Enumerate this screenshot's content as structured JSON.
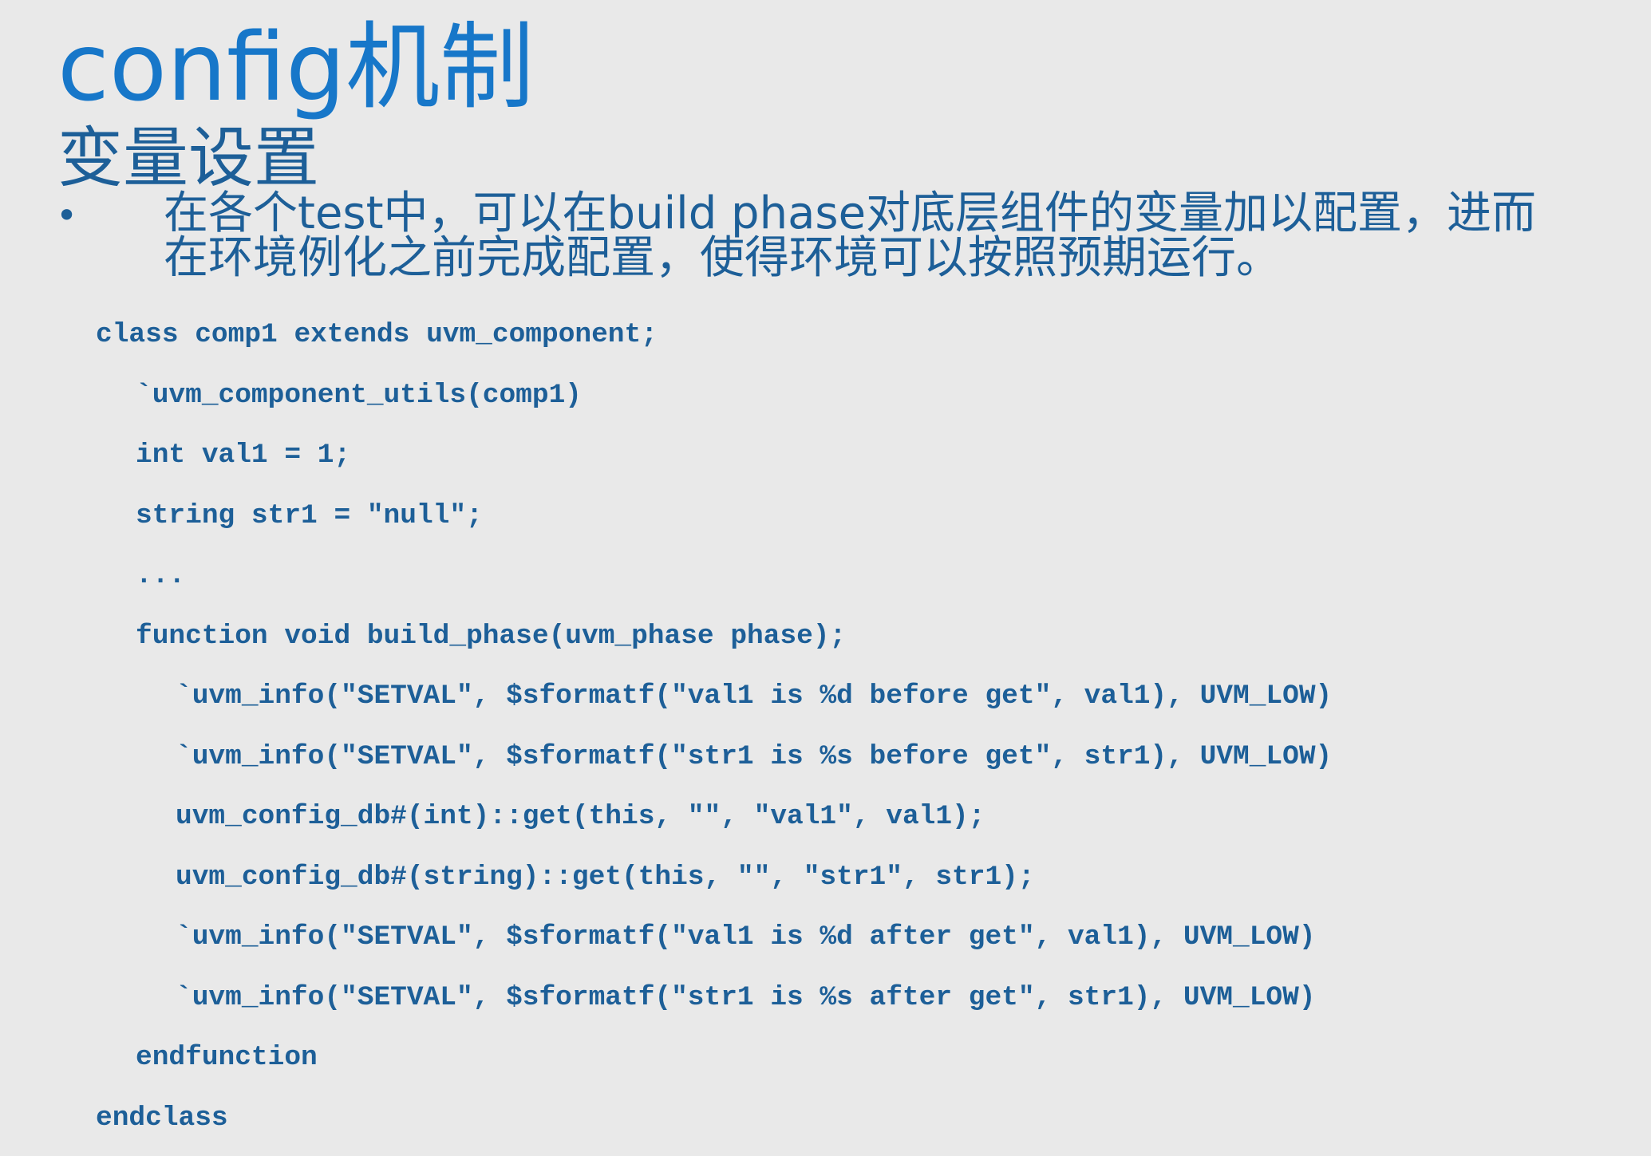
{
  "slide": {
    "title": "config机制",
    "subtitle": "变量设置",
    "bullet": {
      "marker": "•",
      "lines": [
        "在各个test中，可以在build phase对底层组件的变量加以配置，进而",
        "在环境例化之前完成配置，使得环境可以按照预期运行。"
      ]
    },
    "code": [
      "class comp1 extends uvm_component;",
      "`uvm_component_utils(comp1)",
      "int val1 = 1;",
      "string str1 = \"null\";",
      "...",
      "function void build_phase(uvm_phase phase);",
      "`uvm_info(\"SETVAL\", $sformatf(\"val1 is %d before get\", val1), UVM_LOW)",
      "`uvm_info(\"SETVAL\", $sformatf(\"str1 is %s before get\", str1), UVM_LOW)",
      "uvm_config_db#(int)::get(this, \"\", \"val1\", val1);",
      "uvm_config_db#(string)::get(this, \"\", \"str1\", str1);",
      "`uvm_info(\"SETVAL\", $sformatf(\"val1 is %d after get\", val1), UVM_LOW)",
      "`uvm_info(\"SETVAL\", $sformatf(\"str1 is %s after get\", str1), UVM_LOW)",
      "endfunction",
      "endclass"
    ]
  },
  "colors": {
    "background": "#e9e9e9",
    "title": "#1777c9",
    "text": "#1d5f98"
  }
}
